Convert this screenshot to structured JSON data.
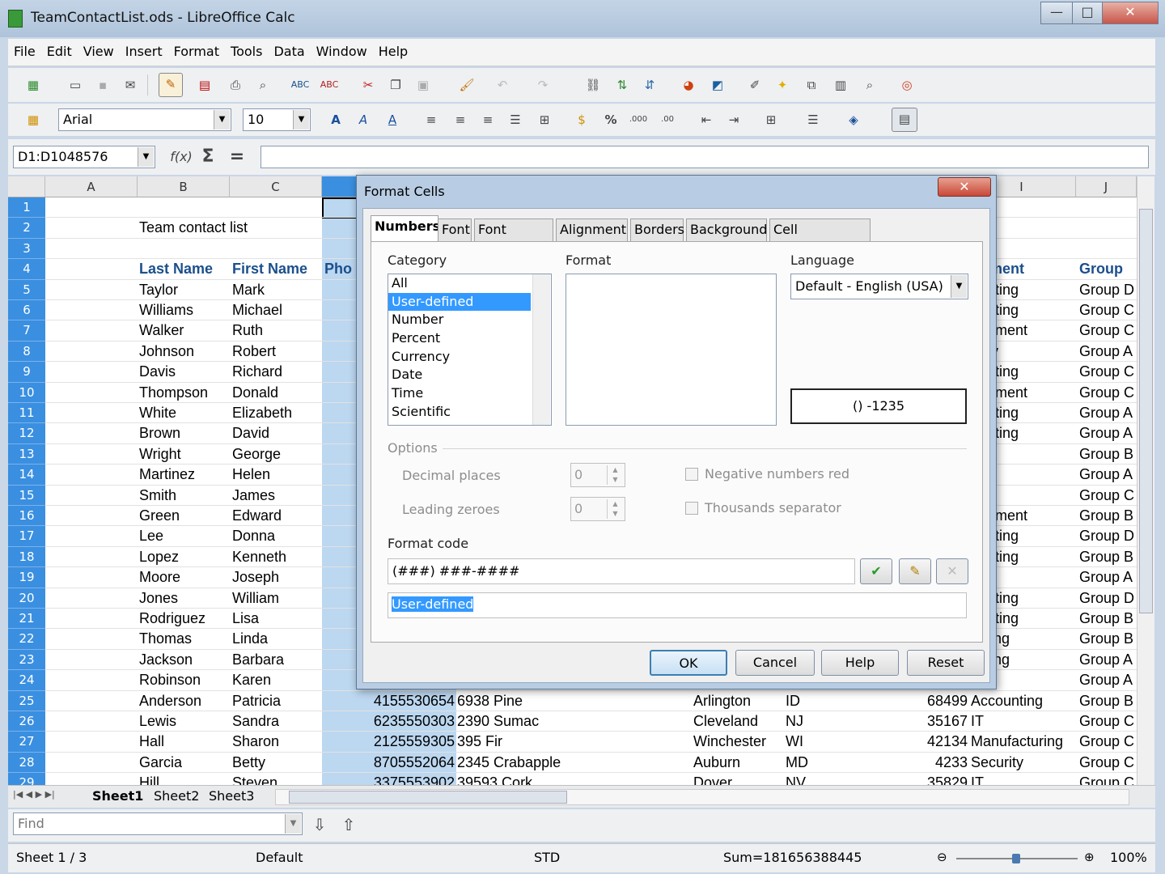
{
  "window": {
    "title": "TeamContactList.ods - LibreOffice Calc",
    "buttons": [
      "—",
      "□",
      "✕"
    ]
  },
  "menu": [
    "File",
    "Edit",
    "View",
    "Insert",
    "Format",
    "Tools",
    "Data",
    "Window",
    "Help"
  ],
  "format_toolbar": {
    "font_name": "Arial",
    "font_size": "10"
  },
  "formula_bar": {
    "name_box": "D1:D1048576",
    "fx": "f(x)",
    "sum": "Σ",
    "equals": "=",
    "content": ""
  },
  "columns": [
    "A",
    "B",
    "C",
    "",
    "",
    "",
    "",
    "",
    "I",
    "J"
  ],
  "rows": [
    "1",
    "2",
    "3",
    "4",
    "5",
    "6",
    "7",
    "8",
    "9",
    "10",
    "11",
    "12",
    "13",
    "14",
    "15",
    "16",
    "17",
    "18",
    "19",
    "20",
    "21",
    "22",
    "23",
    "24",
    "25",
    "26",
    "27",
    "28",
    "29"
  ],
  "sheet": {
    "title_cell": "Team contact list",
    "headers": {
      "last": "Last Name",
      "first": "First Name",
      "phone": "Pho",
      "dept": "artment",
      "group": "Group"
    },
    "last_names": [
      "Taylor",
      "Williams",
      "Walker",
      "Johnson",
      "Davis",
      "Thompson",
      "White",
      "Brown",
      "Wright",
      "Martinez",
      "Smith",
      "Green",
      "Lee",
      "Lopez",
      "Moore",
      "Jones",
      "Rodriguez",
      "Thomas",
      "Jackson",
      "Robinson",
      "Anderson",
      "Lewis",
      "Hall",
      "Garcia",
      "Hill"
    ],
    "first_names": [
      "Mark",
      "Michael",
      "Ruth",
      "Robert",
      "Richard",
      "Donald",
      "Elizabeth",
      "David",
      "George",
      "Helen",
      "James",
      "Edward",
      "Donna",
      "Kenneth",
      "Joseph",
      "William",
      "Lisa",
      "Linda",
      "Barbara",
      "Karen",
      "Patricia",
      "Sandra",
      "Sharon",
      "Betty",
      "Steven"
    ],
    "dept_partial": [
      "ounting",
      "ounting",
      "agement",
      "urity",
      "ounting",
      "agement",
      "ounting",
      "ounting",
      "",
      "",
      "",
      "agement",
      "ounting",
      "ounting",
      "",
      "ounting",
      "ounting",
      "keting",
      "keting",
      "",
      "Accounting",
      "IT",
      "Manufacturing",
      "Security",
      "IT"
    ],
    "groups": [
      "Group D",
      "Group C",
      "Group C",
      "Group A",
      "Group C",
      "Group C",
      "Group A",
      "Group A",
      "Group B",
      "Group A",
      "Group C",
      "Group B",
      "Group D",
      "Group B",
      "Group A",
      "Group D",
      "Group B",
      "Group B",
      "Group A",
      "Group A",
      "Group B",
      "Group C",
      "Group C",
      "Group C",
      "Group C"
    ],
    "lower_rows": [
      {
        "phone": "4155530654",
        "address": "6938 Pine",
        "city": "Arlington",
        "state": "ID",
        "zip": "68499"
      },
      {
        "phone": "6235550303",
        "address": "2390 Sumac",
        "city": "Cleveland",
        "state": "NJ",
        "zip": "35167"
      },
      {
        "phone": "2125559305",
        "address": "395 Fir",
        "city": "Winchester",
        "state": "WI",
        "zip": "42134"
      },
      {
        "phone": "8705552064",
        "address": "2345 Crabapple",
        "city": "Auburn",
        "state": "MD",
        "zip": "4233"
      },
      {
        "phone": "3375553902",
        "address": "39593 Cork",
        "city": "Dover",
        "state": "NV",
        "zip": "35829"
      }
    ]
  },
  "dialog": {
    "title": "Format Cells",
    "tabs": [
      "Numbers",
      "Font",
      "Font Effects",
      "Alignment",
      "Borders",
      "Background",
      "Cell Protection"
    ],
    "category_label": "Category",
    "categories": [
      "All",
      "User-defined",
      "Number",
      "Percent",
      "Currency",
      "Date",
      "Time",
      "Scientific"
    ],
    "selected_category": "User-defined",
    "format_label": "Format",
    "language_label": "Language",
    "language_value": "Default - English (USA)",
    "preview": "() -1235",
    "options_label": "Options",
    "decimal_places_label": "Decimal places",
    "decimal_places_value": "0",
    "leading_zeroes_label": "Leading zeroes",
    "leading_zeroes_value": "0",
    "negative_red_label": "Negative numbers red",
    "thousands_label": "Thousands separator",
    "format_code_label": "Format code",
    "format_code_value": "(###) ###-####",
    "description_value": "User-defined",
    "buttons": {
      "ok": "OK",
      "cancel": "Cancel",
      "help": "Help",
      "reset": "Reset"
    }
  },
  "sheet_tabs": [
    "Sheet1",
    "Sheet2",
    "Sheet3"
  ],
  "find": {
    "placeholder": "Find"
  },
  "status": {
    "sheet": "Sheet 1 / 3",
    "style": "Default",
    "mode": "STD",
    "sum": "Sum=181656388445",
    "zoom": "100%"
  }
}
